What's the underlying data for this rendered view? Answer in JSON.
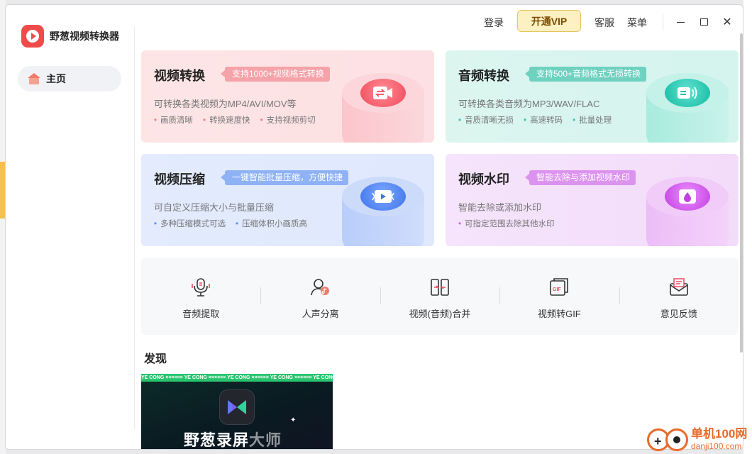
{
  "app": {
    "title": "野葱视频转换器"
  },
  "sidebar": {
    "items": [
      {
        "label": "主页"
      }
    ]
  },
  "topbar": {
    "login": "登录",
    "vip": "开通VIP",
    "service": "客服",
    "menu": "菜单",
    "close_glyph": "✕"
  },
  "cards": [
    {
      "title": "视频转换",
      "tag": "支持1000+视频格式转换",
      "desc": "可转换各类视频为MP4/AVI/MOV等",
      "bullets": [
        "画质清晰",
        "转换速度快",
        "支持视频剪切"
      ],
      "accent": "#f04a5c"
    },
    {
      "title": "音频转换",
      "tag": "支持500+音频格式无损转换",
      "desc": "可转换各类音频为MP3/WAV/FLAC",
      "bullets": [
        "音质清晰无损",
        "高速转码",
        "批量处理"
      ],
      "accent": "#13b9a2"
    },
    {
      "title": "视频压缩",
      "tag": "一键智能批量压缩，方便快捷",
      "desc": "可自定义压缩大小与批量压缩",
      "bullets": [
        "多种压缩模式可选",
        "压缩体积小画质高"
      ],
      "accent": "#3f73ea"
    },
    {
      "title": "视频水印",
      "tag": "智能去除与添加视频水印",
      "desc": "智能去除或添加水印",
      "bullets": [
        "可指定范围去除其他水印"
      ],
      "accent": "#c23fe2"
    }
  ],
  "tools": [
    {
      "label": "音频提取",
      "icon": "microphone-icon"
    },
    {
      "label": "人声分离",
      "icon": "voice-separation-icon"
    },
    {
      "label": "视频(音频)合并",
      "icon": "merge-icon"
    },
    {
      "label": "视频转GIF",
      "icon": "gif-icon"
    },
    {
      "label": "意见反馈",
      "icon": "feedback-mail-icon"
    }
  ],
  "discover": {
    "title": "发现",
    "promo": {
      "strip": "YE CONG ××××××   YE CONG ××××××   YE CONG ××××××   YE CONG ××××××   YE CONG ××××××",
      "title_main": "野葱录屏",
      "title_sub": "大师"
    }
  },
  "watermark": {
    "site": "单机100网",
    "domain": "danji100.com"
  }
}
